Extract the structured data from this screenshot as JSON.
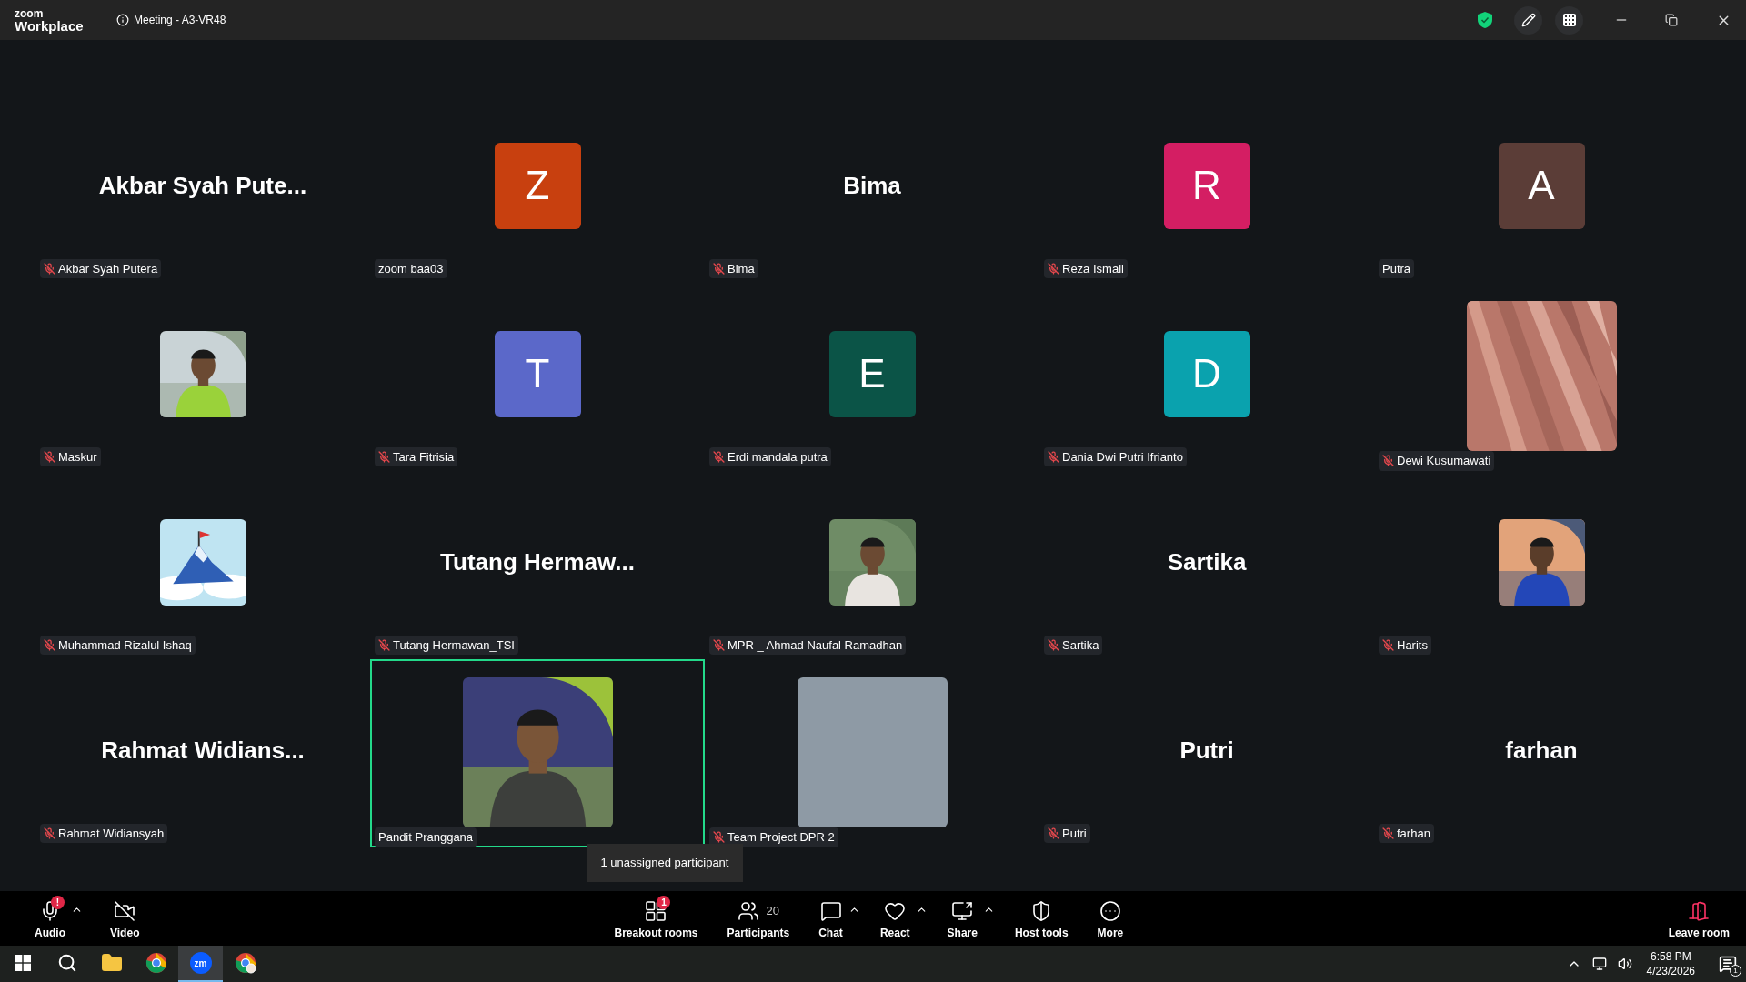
{
  "window": {
    "logo_top": "zoom",
    "logo_bottom": "Workplace",
    "title": "Meeting - A3-VR48"
  },
  "tiles": [
    {
      "kind": "name",
      "display": "Akbar Syah Pute...",
      "name": "Akbar Syah Putera",
      "muted": true,
      "speaking": false
    },
    {
      "kind": "avatar",
      "letter": "Z",
      "color": "#c8400f",
      "name": "zoom baa03",
      "muted": false,
      "speaking": false
    },
    {
      "kind": "name",
      "display": "Bima",
      "name": "Bima",
      "muted": true,
      "speaking": false
    },
    {
      "kind": "avatar",
      "letter": "R",
      "color": "#d41e63",
      "name": "Reza Ismail",
      "muted": true,
      "speaking": false
    },
    {
      "kind": "avatar",
      "letter": "A",
      "color": "#5b3d37",
      "name": "Putra",
      "muted": false,
      "speaking": false
    },
    {
      "kind": "picture",
      "name": "Maskur",
      "muted": true,
      "speaking": false
    },
    {
      "kind": "avatar",
      "letter": "T",
      "color": "#5b68c9",
      "name": "Tara Fitrisia",
      "muted": true,
      "speaking": false
    },
    {
      "kind": "avatar",
      "letter": "E",
      "color": "#0b5447",
      "name": "Erdi mandala putra",
      "muted": true,
      "speaking": false
    },
    {
      "kind": "avatar",
      "letter": "D",
      "color": "#0aa2ae",
      "name": "Dania Dwi Putri Ifrianto",
      "muted": true,
      "speaking": false
    },
    {
      "kind": "picture",
      "name": "Dewi Kusumawati",
      "muted": true,
      "speaking": false
    },
    {
      "kind": "picture",
      "name": "Muhammad Rizalul Ishaq",
      "muted": true,
      "speaking": false
    },
    {
      "kind": "name",
      "display": "Tutang Hermaw...",
      "name": "Tutang Hermawan_TSI",
      "muted": true,
      "speaking": false
    },
    {
      "kind": "picture",
      "name": "MPR _ Ahmad Naufal Ramadhan",
      "muted": true,
      "speaking": false
    },
    {
      "kind": "name",
      "display": "Sartika",
      "name": "Sartika",
      "muted": true,
      "speaking": false
    },
    {
      "kind": "picture",
      "name": "Harits",
      "muted": true,
      "speaking": false
    },
    {
      "kind": "name",
      "display": "Rahmat Widians...",
      "name": "Rahmat Widiansyah",
      "muted": true,
      "speaking": false
    },
    {
      "kind": "picture",
      "name": "Pandit Pranggana",
      "muted": false,
      "speaking": true
    },
    {
      "kind": "blank",
      "name": "Team Project DPR 2",
      "muted": true,
      "speaking": false
    },
    {
      "kind": "name",
      "display": "Putri",
      "name": "Putri",
      "muted": true,
      "speaking": false
    },
    {
      "kind": "name",
      "display": "farhan",
      "name": "farhan",
      "muted": true,
      "speaking": false
    }
  ],
  "tooltip": "1 unassigned participant",
  "toolbar": {
    "left": [
      {
        "kind": "audio",
        "label": "Audio",
        "badge": "!",
        "caret": true
      },
      {
        "kind": "video",
        "label": "Video",
        "caret": false
      }
    ],
    "center": [
      {
        "kind": "breakout",
        "label": "Breakout rooms",
        "badge": "1",
        "caret": false
      },
      {
        "kind": "participants",
        "label": "Participants",
        "count": "20",
        "caret": false
      },
      {
        "kind": "chat",
        "label": "Chat",
        "caret": true
      },
      {
        "kind": "react",
        "label": "React",
        "caret": true
      },
      {
        "kind": "share",
        "label": "Share",
        "caret": true
      },
      {
        "kind": "host",
        "label": "Host tools",
        "caret": false
      },
      {
        "kind": "more",
        "label": "More",
        "caret": false
      }
    ],
    "right": [
      {
        "kind": "leave",
        "label": "Leave room",
        "caret": false
      }
    ]
  },
  "taskbar": {
    "apps": [
      {
        "kind": "start",
        "selected": false
      },
      {
        "kind": "search",
        "selected": false
      },
      {
        "kind": "explorer",
        "selected": false
      },
      {
        "kind": "chrome",
        "selected": false
      },
      {
        "kind": "zoom",
        "label": "zm",
        "selected": true
      },
      {
        "kind": "chrome-profile",
        "selected": false
      }
    ],
    "time": "6:58 PM",
    "date": "4/23/2026",
    "notifications": "1"
  }
}
